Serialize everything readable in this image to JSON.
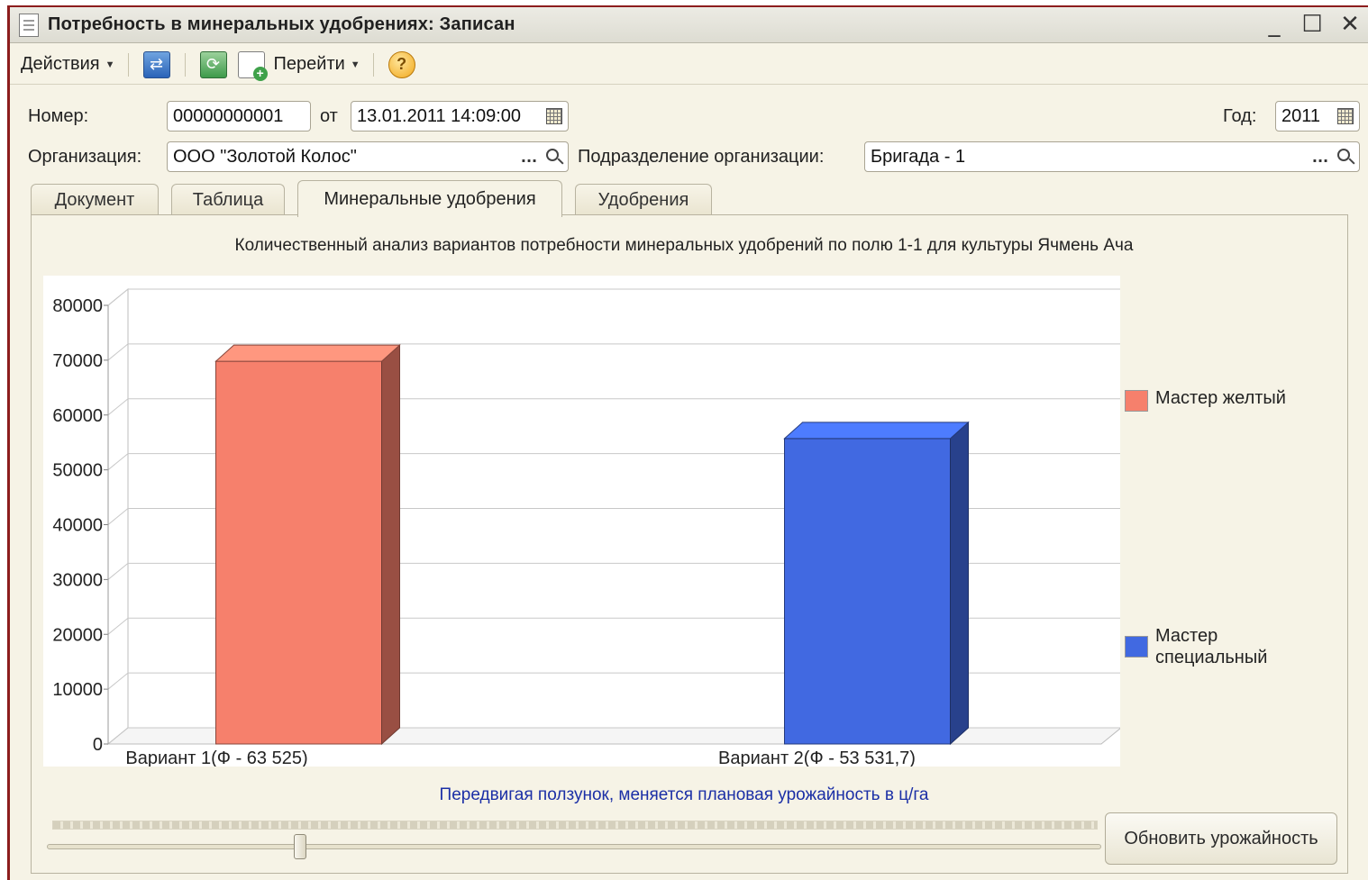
{
  "window": {
    "title": "Потребность в минеральных удобрениях: Записан",
    "minimize": "_",
    "maximize": "☐",
    "close": "✕"
  },
  "toolbar": {
    "actions_label": "Действия",
    "goto_label": "Перейти",
    "help_label": "?"
  },
  "form": {
    "number_label": "Номер:",
    "number_value": "00000000001",
    "date_from_label": "от",
    "date_value": "13.01.2011 14:09:00",
    "year_label": "Год:",
    "year_value": "2011",
    "org_label": "Организация:",
    "org_value": "ООО \"Золотой Колос\"",
    "division_label": "Подразделение организации:",
    "division_value": "Бригада - 1"
  },
  "tabs": [
    {
      "label": "Документ"
    },
    {
      "label": "Таблица"
    },
    {
      "label": "Минеральные удобрения"
    },
    {
      "label": "Удобрения"
    }
  ],
  "active_tab": 2,
  "chart_data": {
    "type": "bar",
    "title": "Количественный анализ вариантов потребности минеральных удобрений по полю 1-1 для культуры Ячмень Ача",
    "categories": [
      "Вариант 1(Ф - 63 525)",
      "Вариант 2(Ф - 53 531,7)"
    ],
    "series": [
      {
        "name": "Мастер желтый",
        "color": "#f6806c",
        "values": [
          69800,
          null
        ]
      },
      {
        "name": "Мастер специальный",
        "color": "#4169e1",
        "values": [
          null,
          55700
        ]
      }
    ],
    "y_ticks": [
      "0",
      "10000",
      "20000",
      "30000",
      "40000",
      "50000",
      "60000",
      "70000",
      "80000"
    ],
    "ylim": [
      0,
      80000
    ],
    "grid": true,
    "legend_position": "right",
    "style": "3d-columns"
  },
  "slider": {
    "hint": "Передвигая ползунок, меняется плановая урожайность в ц/га",
    "position_fraction": 0.24
  },
  "refresh_button_label": "Обновить урожайность"
}
